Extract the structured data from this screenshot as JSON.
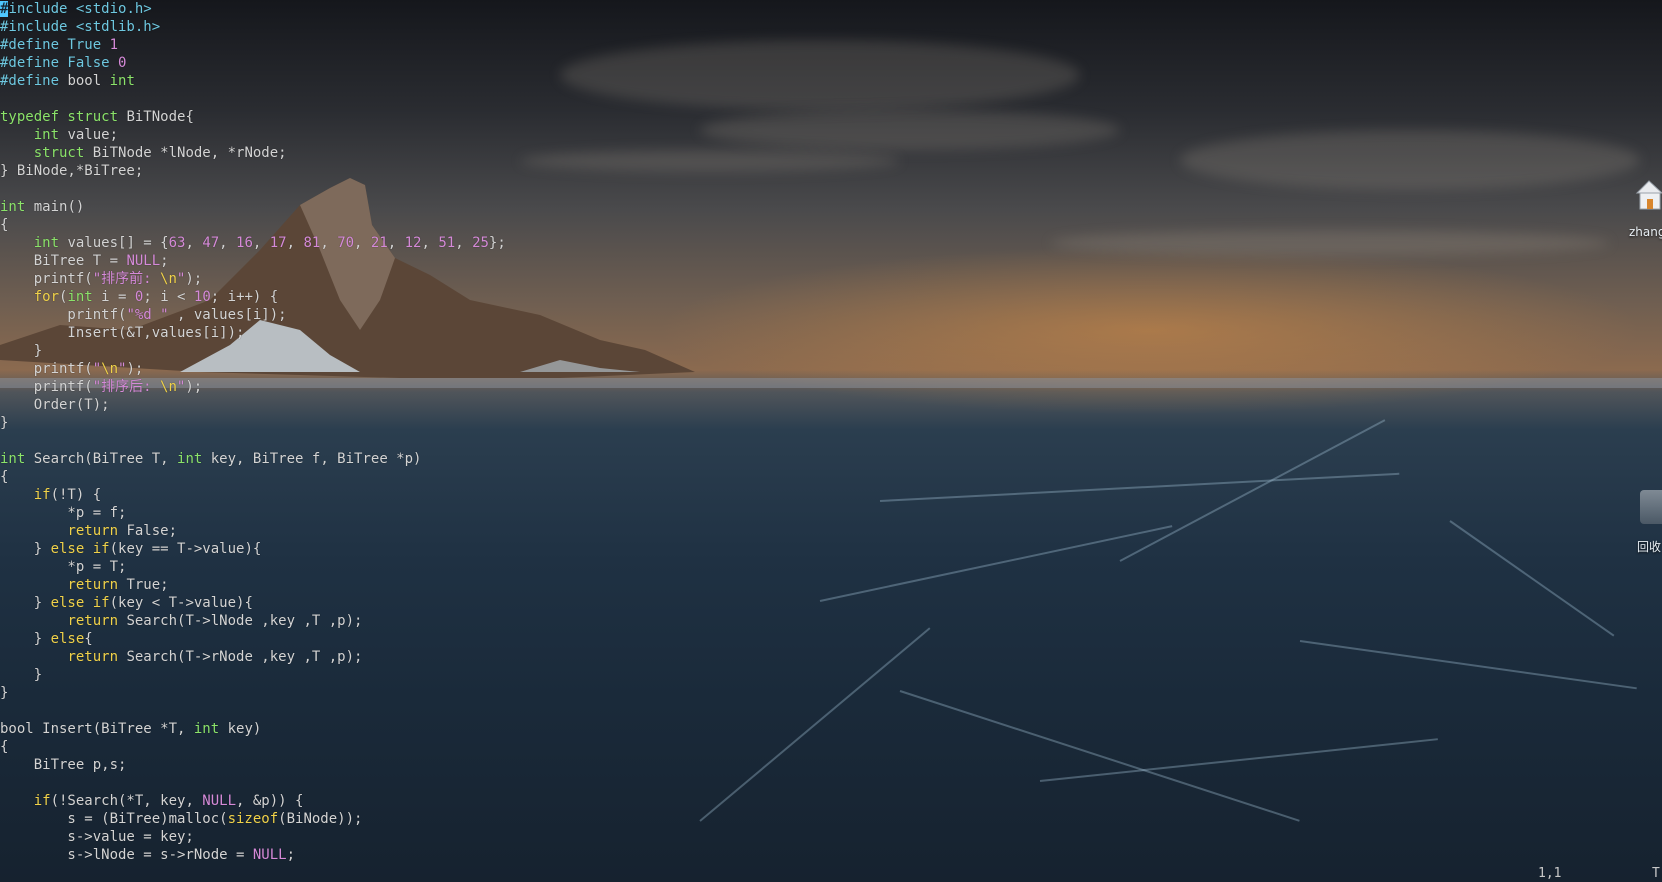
{
  "theme": {
    "plain": "#d4d4d4",
    "preproc": "#6ec8e0",
    "keyword": "#f0d24a",
    "type": "#8be36a",
    "string": "#d58ad8",
    "number": "#d58ad8",
    "constant": "#d58ad8",
    "cursor": "#4fc8ff"
  },
  "editor": {
    "lines": [
      [
        [
          "cursor",
          "#"
        ],
        [
          "preproc",
          "include <stdio.h>"
        ]
      ],
      [
        [
          "preproc",
          "#include <stdlib.h>"
        ]
      ],
      [
        [
          "preproc",
          "#define True "
        ],
        [
          "number",
          "1"
        ]
      ],
      [
        [
          "preproc",
          "#define False "
        ],
        [
          "number",
          "0"
        ]
      ],
      [
        [
          "preproc",
          "#define "
        ],
        [
          "plain",
          "bool "
        ],
        [
          "type",
          "int"
        ]
      ],
      [],
      [
        [
          "type",
          "typedef struct"
        ],
        [
          "plain",
          " BiTNode{"
        ]
      ],
      [
        [
          "plain",
          "    "
        ],
        [
          "type",
          "int"
        ],
        [
          "plain",
          " value;"
        ]
      ],
      [
        [
          "plain",
          "    "
        ],
        [
          "type",
          "struct"
        ],
        [
          "plain",
          " BiTNode *lNode, *rNode;"
        ]
      ],
      [
        [
          "plain",
          "} BiNode,*BiTree;"
        ]
      ],
      [],
      [
        [
          "type",
          "int"
        ],
        [
          "plain",
          " main()"
        ]
      ],
      [
        [
          "plain",
          "{"
        ]
      ],
      [
        [
          "plain",
          "    "
        ],
        [
          "type",
          "int"
        ],
        [
          "plain",
          " values[] = {"
        ],
        [
          "number",
          "63"
        ],
        [
          "plain",
          ", "
        ],
        [
          "number",
          "47"
        ],
        [
          "plain",
          ", "
        ],
        [
          "number",
          "16"
        ],
        [
          "plain",
          ", "
        ],
        [
          "number",
          "17"
        ],
        [
          "plain",
          ", "
        ],
        [
          "number",
          "81"
        ],
        [
          "plain",
          ", "
        ],
        [
          "number",
          "70"
        ],
        [
          "plain",
          ", "
        ],
        [
          "number",
          "21"
        ],
        [
          "plain",
          ", "
        ],
        [
          "number",
          "12"
        ],
        [
          "plain",
          ", "
        ],
        [
          "number",
          "51"
        ],
        [
          "plain",
          ", "
        ],
        [
          "number",
          "25"
        ],
        [
          "plain",
          "};"
        ]
      ],
      [
        [
          "plain",
          "    BiTree T = "
        ],
        [
          "constant",
          "NULL"
        ],
        [
          "plain",
          ";"
        ]
      ],
      [
        [
          "plain",
          "    printf("
        ],
        [
          "string",
          "\"排序前: "
        ],
        [
          "keyword",
          "\\n"
        ],
        [
          "string",
          "\""
        ],
        [
          "plain",
          ");"
        ]
      ],
      [
        [
          "plain",
          "    "
        ],
        [
          "keyword",
          "for"
        ],
        [
          "plain",
          "("
        ],
        [
          "type",
          "int"
        ],
        [
          "plain",
          " i = "
        ],
        [
          "number",
          "0"
        ],
        [
          "plain",
          "; i < "
        ],
        [
          "number",
          "10"
        ],
        [
          "plain",
          "; i++) {"
        ]
      ],
      [
        [
          "plain",
          "        printf("
        ],
        [
          "string",
          "\"%d \""
        ],
        [
          "plain",
          " , values[i]);"
        ]
      ],
      [
        [
          "plain",
          "        Insert(&T,values[i]);"
        ]
      ],
      [
        [
          "plain",
          "    }"
        ]
      ],
      [
        [
          "plain",
          "    printf("
        ],
        [
          "string",
          "\""
        ],
        [
          "keyword",
          "\\n"
        ],
        [
          "string",
          "\""
        ],
        [
          "plain",
          ");"
        ]
      ],
      [
        [
          "plain",
          "    printf("
        ],
        [
          "string",
          "\"排序后: "
        ],
        [
          "keyword",
          "\\n"
        ],
        [
          "string",
          "\""
        ],
        [
          "plain",
          ");"
        ]
      ],
      [
        [
          "plain",
          "    Order(T);"
        ]
      ],
      [
        [
          "plain",
          "}"
        ]
      ],
      [],
      [
        [
          "type",
          "int"
        ],
        [
          "plain",
          " Search(BiTree T, "
        ],
        [
          "type",
          "int"
        ],
        [
          "plain",
          " key, BiTree f, BiTree *p)"
        ]
      ],
      [
        [
          "plain",
          "{"
        ]
      ],
      [
        [
          "plain",
          "    "
        ],
        [
          "keyword",
          "if"
        ],
        [
          "plain",
          "(!T) {"
        ]
      ],
      [
        [
          "plain",
          "        *p = f;"
        ]
      ],
      [
        [
          "plain",
          "        "
        ],
        [
          "keyword",
          "return"
        ],
        [
          "plain",
          " False;"
        ]
      ],
      [
        [
          "plain",
          "    } "
        ],
        [
          "keyword",
          "else if"
        ],
        [
          "plain",
          "(key == T->value){"
        ]
      ],
      [
        [
          "plain",
          "        *p = T;"
        ]
      ],
      [
        [
          "plain",
          "        "
        ],
        [
          "keyword",
          "return"
        ],
        [
          "plain",
          " True;"
        ]
      ],
      [
        [
          "plain",
          "    } "
        ],
        [
          "keyword",
          "else if"
        ],
        [
          "plain",
          "(key < T->value){"
        ]
      ],
      [
        [
          "plain",
          "        "
        ],
        [
          "keyword",
          "return"
        ],
        [
          "plain",
          " Search(T->lNode ,key ,T ,p);"
        ]
      ],
      [
        [
          "plain",
          "    } "
        ],
        [
          "keyword",
          "else"
        ],
        [
          "plain",
          "{"
        ]
      ],
      [
        [
          "plain",
          "        "
        ],
        [
          "keyword",
          "return"
        ],
        [
          "plain",
          " Search(T->rNode ,key ,T ,p);"
        ]
      ],
      [
        [
          "plain",
          "    }"
        ]
      ],
      [
        [
          "plain",
          "}"
        ]
      ],
      [],
      [
        [
          "plain",
          "bool Insert(BiTree *T, "
        ],
        [
          "type",
          "int"
        ],
        [
          "plain",
          " key)"
        ]
      ],
      [
        [
          "plain",
          "{"
        ]
      ],
      [
        [
          "plain",
          "    BiTree p,s;"
        ]
      ],
      [],
      [
        [
          "plain",
          "    "
        ],
        [
          "keyword",
          "if"
        ],
        [
          "plain",
          "(!Search(*T, key, "
        ],
        [
          "constant",
          "NULL"
        ],
        [
          "plain",
          ", &p)) {"
        ]
      ],
      [
        [
          "plain",
          "        s = (BiTree)malloc("
        ],
        [
          "keyword",
          "sizeof"
        ],
        [
          "plain",
          "(BiNode));"
        ]
      ],
      [
        [
          "plain",
          "        s->value = key;"
        ]
      ],
      [
        [
          "plain",
          "        s->lNode = s->rNode = "
        ],
        [
          "constant",
          "NULL"
        ],
        [
          "plain",
          ";"
        ]
      ]
    ]
  },
  "desktop": {
    "home_label": "zhang",
    "trash_label": "回收"
  },
  "status": {
    "cursor_position": "1,1",
    "mode_indicator": "T"
  }
}
